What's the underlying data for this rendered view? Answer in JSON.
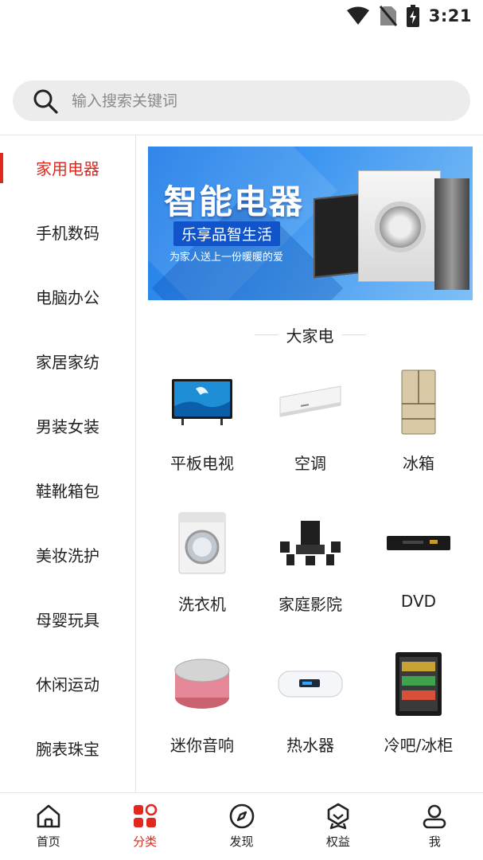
{
  "status_bar": {
    "time": "3:21"
  },
  "search": {
    "placeholder": "输入搜索关键词"
  },
  "sidebar": {
    "items": [
      {
        "label": "家用电器",
        "active": true
      },
      {
        "label": "手机数码"
      },
      {
        "label": "电脑办公"
      },
      {
        "label": "家居家纺"
      },
      {
        "label": "男装女装"
      },
      {
        "label": "鞋靴箱包"
      },
      {
        "label": "美妆洗护"
      },
      {
        "label": "母婴玩具"
      },
      {
        "label": "休闲运动"
      },
      {
        "label": "腕表珠宝"
      }
    ]
  },
  "banner": {
    "title": "智能电器",
    "subtitle": "乐享品智生活",
    "tagline": "为家人送上一份暖暖的爱"
  },
  "section": {
    "title": "大家电",
    "items": [
      {
        "label": "平板电视",
        "icon": "tv-icon"
      },
      {
        "label": "空调",
        "icon": "air-conditioner-icon"
      },
      {
        "label": "冰箱",
        "icon": "refrigerator-icon"
      },
      {
        "label": "洗衣机",
        "icon": "washing-machine-icon"
      },
      {
        "label": "家庭影院",
        "icon": "home-theater-icon"
      },
      {
        "label": "DVD",
        "icon": "dvd-player-icon"
      },
      {
        "label": "迷你音响",
        "icon": "mini-speaker-icon"
      },
      {
        "label": "热水器",
        "icon": "water-heater-icon"
      },
      {
        "label": "冷吧/冰柜",
        "icon": "freezer-icon"
      }
    ]
  },
  "tabbar": {
    "items": [
      {
        "label": "首页",
        "icon": "home-icon"
      },
      {
        "label": "分类",
        "icon": "category-icon",
        "active": true
      },
      {
        "label": "发现",
        "icon": "compass-icon"
      },
      {
        "label": "权益",
        "icon": "badge-icon"
      },
      {
        "label": "我",
        "icon": "user-icon"
      }
    ]
  },
  "colors": {
    "accent": "#e0281f",
    "banner_blue": "#1a78e6"
  }
}
